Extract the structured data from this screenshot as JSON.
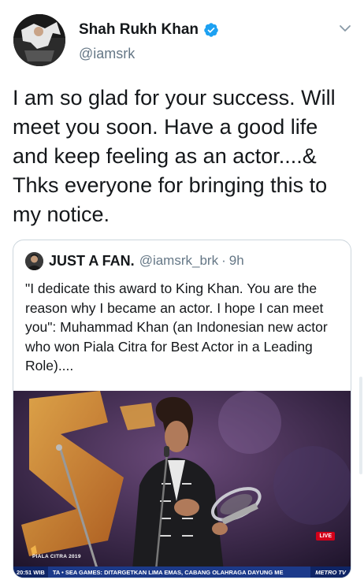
{
  "author": {
    "name": "Shah Rukh Khan",
    "handle": "@iamsrk",
    "verified": true,
    "avatar_icon": "profile-photo"
  },
  "tweet": {
    "text": "I am so glad for your success. Will meet you soon. Have a good life and keep feeling as an actor....& Thks everyone for bringing this to my notice."
  },
  "quote": {
    "name": "JUST A FAN.",
    "handle": "@iamsrk_brk",
    "separator": "·",
    "time": "9h",
    "text": "\"I dedicate this award to King Khan. You are the reason why I became an actor. I hope I can meet you\": Muhammad Khan (an Indonesian new actor who won Piala Citra for Best Actor in a Leading Role)....",
    "media": {
      "caption": "PIALA CITRA 2019",
      "live_badge": "LIVE",
      "ticker_time": "20:51 WIB",
      "ticker_text": "TA • SEA GAMES: DITARGETKAN LIMA EMAS, CABANG OLAHRAGA DAYUNG ME",
      "ticker_brand": "METRO TV"
    }
  },
  "colors": {
    "verified": "#1da1f2",
    "secondary_text": "#657786",
    "border": "#ccd6dd"
  }
}
